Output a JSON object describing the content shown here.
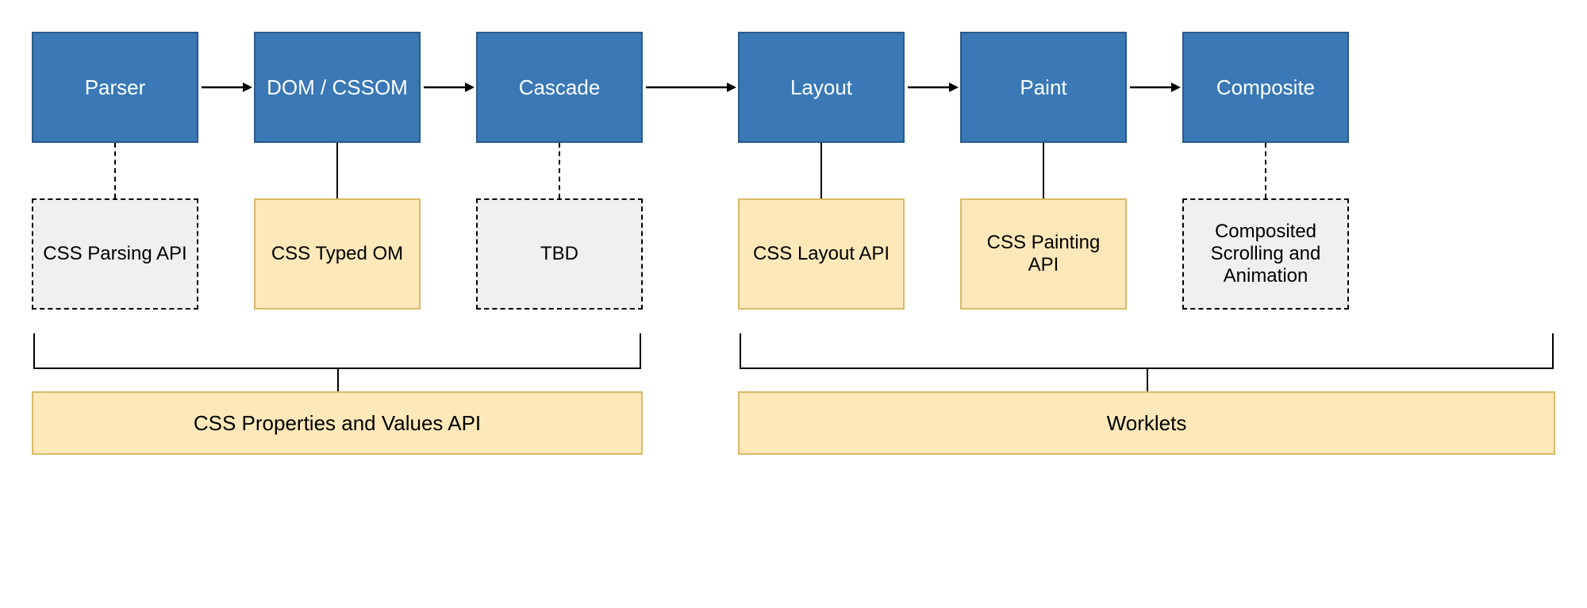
{
  "stages": {
    "parser": "Parser",
    "dom": "DOM / CSSOM",
    "cascade": "Cascade",
    "layout": "Layout",
    "paint": "Paint",
    "composite": "Composite"
  },
  "apis": {
    "parsing": "CSS Parsing API",
    "typedom": "CSS Typed OM",
    "tbd": "TBD",
    "layout": "CSS Layout API",
    "painting": "CSS Painting API",
    "composited": "Composited Scrolling and Animation"
  },
  "groups": {
    "properties": "CSS Properties and Values API",
    "worklets": "Worklets"
  }
}
